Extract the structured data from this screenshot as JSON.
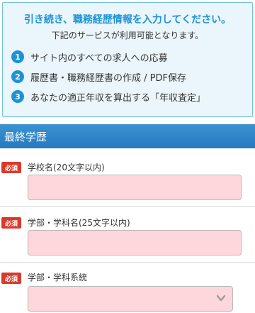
{
  "notice": {
    "title": "引き続き、職務経歴情報を入力してください。",
    "subtitle": "下記のサービスが利用可能となります。",
    "steps": [
      {
        "num": "1",
        "text": "サイト内のすべての求人への応募"
      },
      {
        "num": "2",
        "text": "履歴書・職務経歴書の作成 / PDF保存"
      },
      {
        "num": "3",
        "text": "あなたの適正年収を算出する「年収査定」"
      }
    ]
  },
  "section": {
    "title": "最終学歴"
  },
  "fields": [
    {
      "badge": "必須",
      "label": "学校名(20文字以内)",
      "value": "",
      "placeholder": ""
    },
    {
      "badge": "必須",
      "label": "学部・学科名(25文字以内)",
      "value": "",
      "placeholder": ""
    },
    {
      "badge": "必須",
      "label": "学部・学科系統",
      "selected": ""
    }
  ],
  "colors": {
    "accent": "#1d93d6",
    "header": "#2b80c5",
    "required": "#d93a2b",
    "input_bg": "#fed7dc"
  },
  "icons": {
    "select": "chevron-down-icon"
  }
}
